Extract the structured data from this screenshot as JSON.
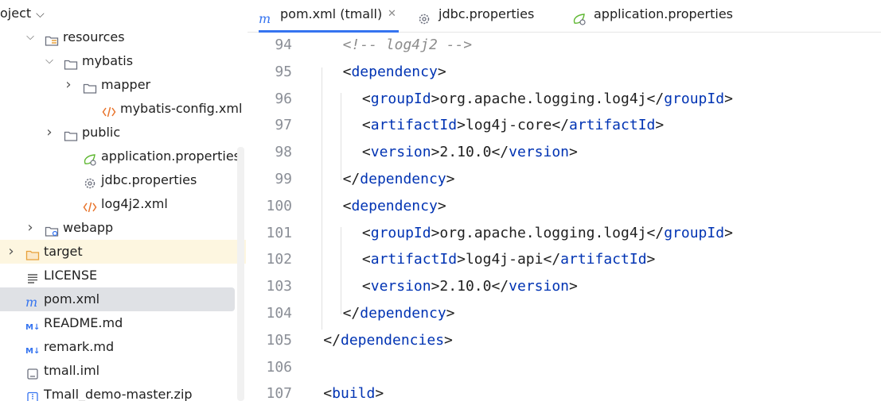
{
  "sidebar": {
    "title": "oject",
    "items": [
      {
        "label": "resources",
        "depth": 1,
        "expanded": true,
        "icon": "resources-folder-icon"
      },
      {
        "label": "mybatis",
        "depth": 2,
        "expanded": true,
        "icon": "folder-icon"
      },
      {
        "label": "mapper",
        "depth": 3,
        "expanded": false,
        "icon": "folder-icon"
      },
      {
        "label": "mybatis-config.xml",
        "depth": 4,
        "icon": "xml-file-icon"
      },
      {
        "label": "public",
        "depth": 2,
        "expanded": false,
        "icon": "folder-icon"
      },
      {
        "label": "application.properties",
        "depth": 3,
        "icon": "spring-properties-icon"
      },
      {
        "label": "jdbc.properties",
        "depth": 3,
        "icon": "properties-gear-icon"
      },
      {
        "label": "log4j2.xml",
        "depth": 3,
        "icon": "xml-file-icon"
      },
      {
        "label": "webapp",
        "depth": 1,
        "expanded": false,
        "icon": "web-folder-icon"
      },
      {
        "label": "target",
        "depth": 0,
        "expanded": false,
        "icon": "excluded-folder-icon"
      },
      {
        "label": "LICENSE",
        "depth": 0,
        "icon": "text-file-icon"
      },
      {
        "label": "pom.xml",
        "depth": 0,
        "icon": "maven-icon"
      },
      {
        "label": "README.md",
        "depth": 0,
        "icon": "markdown-icon"
      },
      {
        "label": "remark.md",
        "depth": 0,
        "icon": "markdown-icon"
      },
      {
        "label": "tmall.iml",
        "depth": 0,
        "icon": "iml-file-icon"
      },
      {
        "label": "Tmall_demo-master.zip",
        "depth": 0,
        "icon": "zip-file-icon"
      }
    ]
  },
  "tabs": [
    {
      "label": "pom.xml (tmall)",
      "icon": "maven-icon",
      "active": true,
      "closable": true
    },
    {
      "label": "jdbc.properties",
      "icon": "properties-gear-icon",
      "active": false
    },
    {
      "label": "application.properties",
      "icon": "spring-properties-icon",
      "active": false
    }
  ],
  "editor": {
    "lines": [
      {
        "num": "94",
        "tokens": [
          {
            "t": "<!-- log4j2 -->",
            "k": "comment"
          }
        ]
      },
      {
        "num": "95",
        "tokens": [
          {
            "t": "<",
            "k": "p"
          },
          {
            "t": "dependency",
            "k": "tag"
          },
          {
            "t": ">",
            "k": "p"
          }
        ]
      },
      {
        "num": "96",
        "tokens": [
          {
            "t": "<",
            "k": "p"
          },
          {
            "t": "groupId",
            "k": "tag"
          },
          {
            "t": ">org.apache.logging.log4j</",
            "k": "p"
          },
          {
            "t": "groupId",
            "k": "tag"
          },
          {
            "t": ">",
            "k": "p"
          }
        ]
      },
      {
        "num": "97",
        "tokens": [
          {
            "t": "<",
            "k": "p"
          },
          {
            "t": "artifactId",
            "k": "tag"
          },
          {
            "t": ">log4j-core</",
            "k": "p"
          },
          {
            "t": "artifactId",
            "k": "tag"
          },
          {
            "t": ">",
            "k": "p"
          }
        ]
      },
      {
        "num": "98",
        "tokens": [
          {
            "t": "<",
            "k": "p"
          },
          {
            "t": "version",
            "k": "tag"
          },
          {
            "t": ">2.10.0</",
            "k": "p"
          },
          {
            "t": "version",
            "k": "tag"
          },
          {
            "t": ">",
            "k": "p"
          }
        ]
      },
      {
        "num": "99",
        "tokens": [
          {
            "t": "</",
            "k": "p"
          },
          {
            "t": "dependency",
            "k": "tag"
          },
          {
            "t": ">",
            "k": "p"
          }
        ]
      },
      {
        "num": "100",
        "tokens": [
          {
            "t": "<",
            "k": "p"
          },
          {
            "t": "dependency",
            "k": "tag"
          },
          {
            "t": ">",
            "k": "p"
          }
        ]
      },
      {
        "num": "101",
        "tokens": [
          {
            "t": "<",
            "k": "p"
          },
          {
            "t": "groupId",
            "k": "tag"
          },
          {
            "t": ">org.apache.logging.log4j</",
            "k": "p"
          },
          {
            "t": "groupId",
            "k": "tag"
          },
          {
            "t": ">",
            "k": "p"
          }
        ]
      },
      {
        "num": "102",
        "tokens": [
          {
            "t": "<",
            "k": "p"
          },
          {
            "t": "artifactId",
            "k": "tag"
          },
          {
            "t": ">log4j-api</",
            "k": "p"
          },
          {
            "t": "artifactId",
            "k": "tag"
          },
          {
            "t": ">",
            "k": "p"
          }
        ]
      },
      {
        "num": "103",
        "tokens": [
          {
            "t": "<",
            "k": "p"
          },
          {
            "t": "version",
            "k": "tag"
          },
          {
            "t": ">2.10.0</",
            "k": "p"
          },
          {
            "t": "version",
            "k": "tag"
          },
          {
            "t": ">",
            "k": "p"
          }
        ]
      },
      {
        "num": "104",
        "tokens": [
          {
            "t": "</",
            "k": "p"
          },
          {
            "t": "dependency",
            "k": "tag"
          },
          {
            "t": ">",
            "k": "p"
          }
        ]
      },
      {
        "num": "105",
        "tokens": [
          {
            "t": "</",
            "k": "p"
          },
          {
            "t": "dependencies",
            "k": "tag"
          },
          {
            "t": ">",
            "k": "p"
          }
        ]
      },
      {
        "num": "106",
        "tokens": []
      },
      {
        "num": "107",
        "tokens": [
          {
            "t": "<",
            "k": "p"
          },
          {
            "t": "build",
            "k": "tag"
          },
          {
            "t": ">",
            "k": "p"
          }
        ]
      }
    ]
  },
  "colors": {
    "accent": "#3574f0",
    "tag": "#0033b3",
    "comment": "#8c8c8c",
    "selection": "#dfe1e5",
    "highlight_row": "#fdf6e0",
    "xml_icon": "#e8732a",
    "spring_icon": "#5fb832"
  }
}
